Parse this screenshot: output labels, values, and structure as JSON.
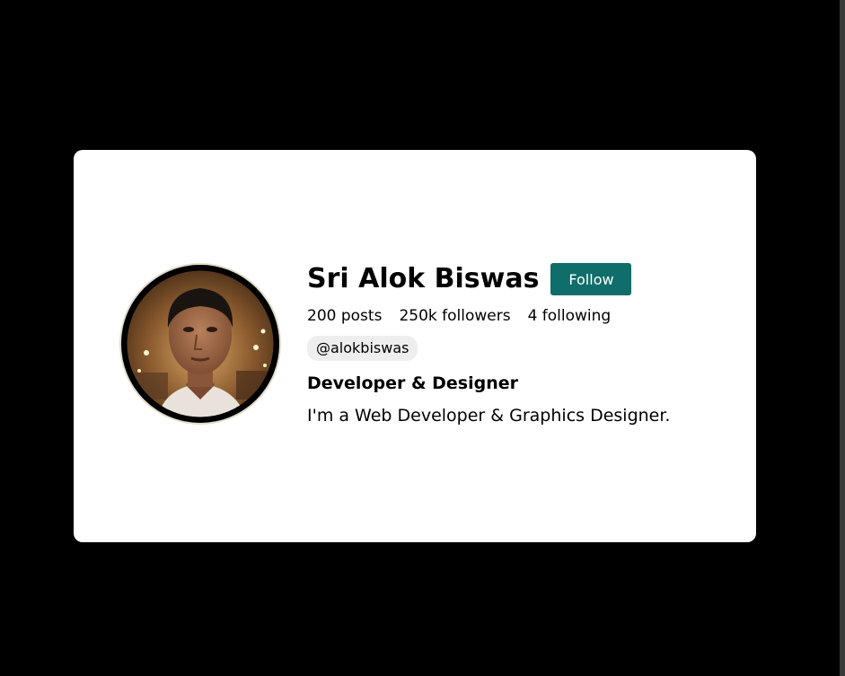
{
  "profile": {
    "name": "Sri Alok Biswas",
    "follow_label": "Follow",
    "stats": {
      "posts": "200 posts",
      "followers": "250k followers",
      "following": "4 following"
    },
    "handle": "@alokbiswas",
    "headline": "Developer & Designer",
    "bio": "I'm a Web Developer & Graphics Designer."
  },
  "colors": {
    "page_background": "#000000",
    "card_background": "#ffffff",
    "follow_button": "#0f6d6a",
    "handle_pill": "#eeeeee",
    "avatar_ring": "#e3dccd"
  }
}
